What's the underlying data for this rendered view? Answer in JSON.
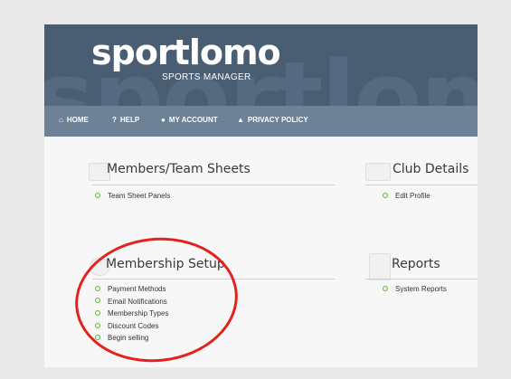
{
  "header": {
    "logo_text": "sportlomo",
    "logo_subtitle": "SPORTS MANAGER",
    "background_word": "sportlomo"
  },
  "nav": [
    {
      "icon": "home-icon",
      "glyph": "⌂",
      "label": "HOME"
    },
    {
      "icon": "help-icon",
      "glyph": "?",
      "label": "HELP"
    },
    {
      "icon": "user-icon",
      "glyph": "●",
      "label": "MY ACCOUNT"
    },
    {
      "icon": "lock-icon",
      "glyph": "▲",
      "label": "PRIVACY POLICY"
    }
  ],
  "sections": {
    "members": {
      "title": "Members/Team Sheets",
      "links": [
        "Team Sheet Panels"
      ]
    },
    "club": {
      "title": "Club Details",
      "links": [
        "Edit Profile"
      ]
    },
    "membership": {
      "title": "Membership Setup",
      "links": [
        "Payment Methods",
        "Email Notifications",
        "Membership Types",
        "Discount Codes",
        "Begin selling"
      ]
    },
    "reports": {
      "title": "Reports",
      "links": [
        "System Reports"
      ]
    }
  },
  "colors": {
    "header_bg": "#4a5e73",
    "nav_bg": "#6d8197",
    "bullet": "#6bb33d",
    "highlight_circle": "#e3231b"
  }
}
